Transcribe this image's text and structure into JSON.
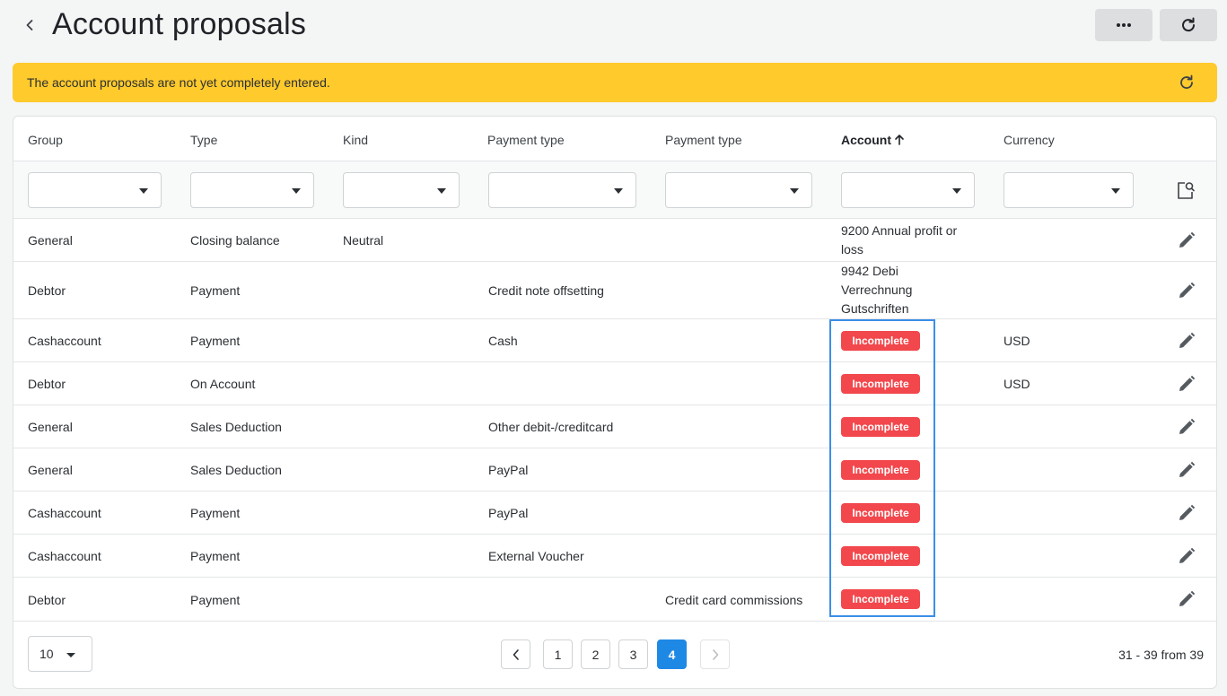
{
  "header": {
    "title": "Account proposals",
    "more_label": "•••"
  },
  "banner": {
    "text": "The account proposals are not yet completely entered."
  },
  "table": {
    "columns": [
      "Group",
      "Type",
      "Kind",
      "Payment type",
      "Payment type",
      "Account",
      "Currency"
    ],
    "sorted_column": "Account",
    "sort_direction": "ascending",
    "rows": [
      {
        "group": "General",
        "type": "Closing balance",
        "kind": "Neutral",
        "payment_type_1": "",
        "payment_type_2": "",
        "account": "9200 Annual profit or loss",
        "currency": ""
      },
      {
        "group": "Debtor",
        "type": "Payment",
        "kind": "",
        "payment_type_1": "Credit note offsetting",
        "payment_type_2": "",
        "account": "9942 Debi Verrechnung Gutschriften",
        "currency": ""
      },
      {
        "group": "Cashaccount",
        "type": "Payment",
        "kind": "",
        "payment_type_1": "Cash",
        "payment_type_2": "",
        "account": "Incomplete",
        "currency": "USD"
      },
      {
        "group": "Debtor",
        "type": "On Account",
        "kind": "",
        "payment_type_1": "",
        "payment_type_2": "",
        "account": "Incomplete",
        "currency": "USD"
      },
      {
        "group": "General",
        "type": "Sales Deduction",
        "kind": "",
        "payment_type_1": "Other debit-/creditcard",
        "payment_type_2": "",
        "account": "Incomplete",
        "currency": ""
      },
      {
        "group": "General",
        "type": "Sales Deduction",
        "kind": "",
        "payment_type_1": "PayPal",
        "payment_type_2": "",
        "account": "Incomplete",
        "currency": ""
      },
      {
        "group": "Cashaccount",
        "type": "Payment",
        "kind": "",
        "payment_type_1": "PayPal",
        "payment_type_2": "",
        "account": "Incomplete",
        "currency": ""
      },
      {
        "group": "Cashaccount",
        "type": "Payment",
        "kind": "",
        "payment_type_1": "External Voucher",
        "payment_type_2": "",
        "account": "Incomplete",
        "currency": ""
      },
      {
        "group": "Debtor",
        "type": "Payment",
        "kind": "",
        "payment_type_1": "",
        "payment_type_2": "Credit card commissions",
        "account": "Incomplete",
        "currency": ""
      }
    ]
  },
  "pagination": {
    "page_size": "10",
    "pages": [
      "1",
      "2",
      "3",
      "4"
    ],
    "current_page": "4",
    "range_text": "31 - 39 from 39"
  },
  "colors": {
    "banner": "#ffca2c",
    "incomplete_badge": "#f2474c",
    "current_page": "#1e88e5",
    "highlight": "#3b8ee8"
  }
}
